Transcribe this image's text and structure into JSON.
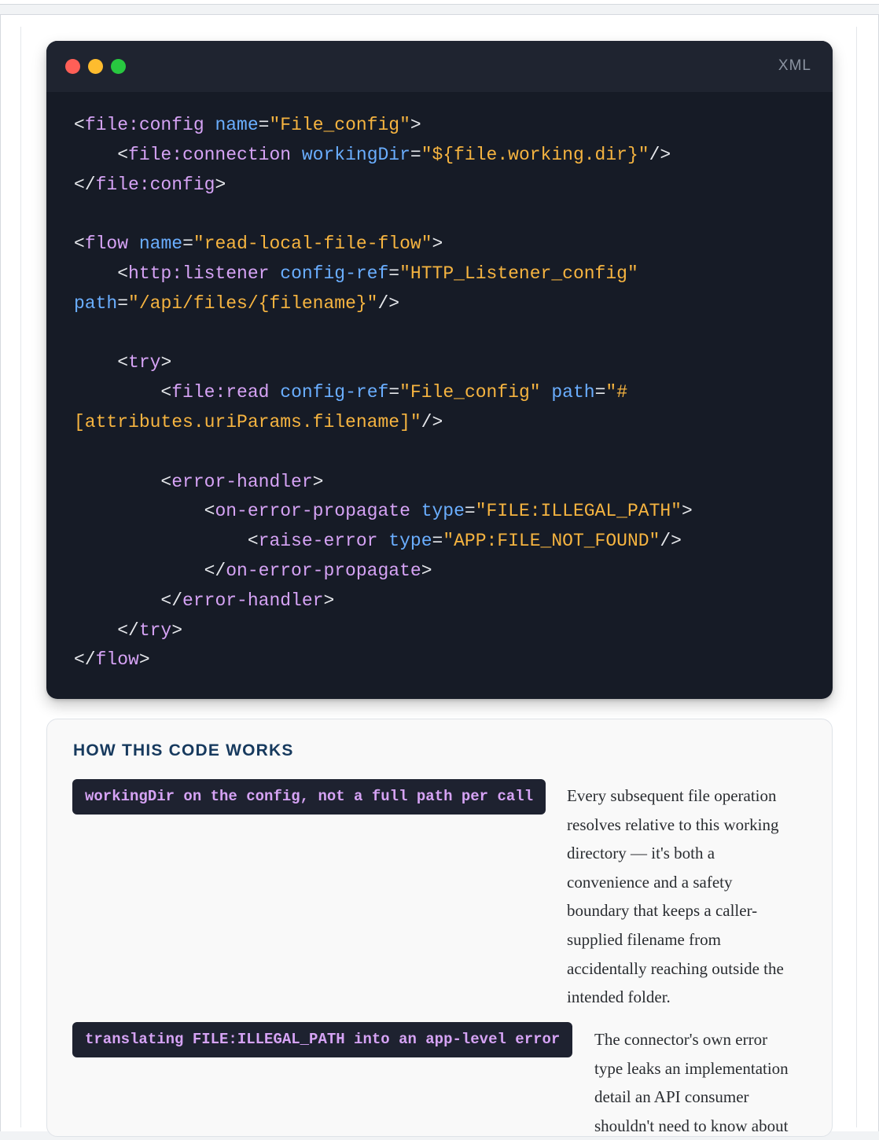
{
  "code_block": {
    "language": "XML",
    "lines": [
      [
        [
          "p",
          "<"
        ],
        [
          "t",
          "file:config"
        ],
        [
          "p",
          " "
        ],
        [
          "a",
          "name"
        ],
        [
          "p",
          "="
        ],
        [
          "s",
          "\"File_config\""
        ],
        [
          "p",
          ">"
        ]
      ],
      [
        [
          "p",
          "    <"
        ],
        [
          "t",
          "file:connection"
        ],
        [
          "p",
          " "
        ],
        [
          "a",
          "workingDir"
        ],
        [
          "p",
          "="
        ],
        [
          "s",
          "\"${file.working.dir}\""
        ],
        [
          "p",
          "/>"
        ]
      ],
      [
        [
          "p",
          "</"
        ],
        [
          "t",
          "file:config"
        ],
        [
          "p",
          ">"
        ]
      ],
      [],
      [
        [
          "p",
          "<"
        ],
        [
          "t",
          "flow"
        ],
        [
          "p",
          " "
        ],
        [
          "a",
          "name"
        ],
        [
          "p",
          "="
        ],
        [
          "s",
          "\"read-local-file-flow\""
        ],
        [
          "p",
          ">"
        ]
      ],
      [
        [
          "p",
          "    <"
        ],
        [
          "t",
          "http:listener"
        ],
        [
          "p",
          " "
        ],
        [
          "a",
          "config-ref"
        ],
        [
          "p",
          "="
        ],
        [
          "s",
          "\"HTTP_Listener_config\""
        ]
      ],
      [
        [
          "a",
          "path"
        ],
        [
          "p",
          "="
        ],
        [
          "s",
          "\"/api/files/{filename}\""
        ],
        [
          "p",
          "/>"
        ]
      ],
      [],
      [
        [
          "p",
          "    <"
        ],
        [
          "t",
          "try"
        ],
        [
          "p",
          ">"
        ]
      ],
      [
        [
          "p",
          "        <"
        ],
        [
          "t",
          "file:read"
        ],
        [
          "p",
          " "
        ],
        [
          "a",
          "config-ref"
        ],
        [
          "p",
          "="
        ],
        [
          "s",
          "\"File_config\""
        ],
        [
          "p",
          " "
        ],
        [
          "a",
          "path"
        ],
        [
          "p",
          "="
        ],
        [
          "s",
          "\"#"
        ]
      ],
      [
        [
          "s",
          "[attributes.uriParams.filename]\""
        ],
        [
          "p",
          "/>"
        ]
      ],
      [],
      [
        [
          "p",
          "        <"
        ],
        [
          "t",
          "error-handler"
        ],
        [
          "p",
          ">"
        ]
      ],
      [
        [
          "p",
          "            <"
        ],
        [
          "t",
          "on-error-propagate"
        ],
        [
          "p",
          " "
        ],
        [
          "a",
          "type"
        ],
        [
          "p",
          "="
        ],
        [
          "s",
          "\"FILE:ILLEGAL_PATH\""
        ],
        [
          "p",
          ">"
        ]
      ],
      [
        [
          "p",
          "                <"
        ],
        [
          "t",
          "raise-error"
        ],
        [
          "p",
          " "
        ],
        [
          "a",
          "type"
        ],
        [
          "p",
          "="
        ],
        [
          "s",
          "\"APP:FILE_NOT_FOUND\""
        ],
        [
          "p",
          "/>"
        ]
      ],
      [
        [
          "p",
          "            </"
        ],
        [
          "t",
          "on-error-propagate"
        ],
        [
          "p",
          ">"
        ]
      ],
      [
        [
          "p",
          "        </"
        ],
        [
          "t",
          "error-handler"
        ],
        [
          "p",
          ">"
        ]
      ],
      [
        [
          "p",
          "    </"
        ],
        [
          "t",
          "try"
        ],
        [
          "p",
          ">"
        ]
      ],
      [
        [
          "p",
          "</"
        ],
        [
          "t",
          "flow"
        ],
        [
          "p",
          ">"
        ]
      ]
    ]
  },
  "explanation": {
    "title": "HOW THIS CODE WORKS",
    "items": [
      {
        "term": "workingDir on the config, not a full path per call",
        "description_lines": [
          "Every subsequent file operation",
          "resolves relative to this working",
          "directory — it's both a",
          "convenience and a safety",
          "boundary that keeps a caller-",
          "supplied filename from",
          "accidentally reaching outside the",
          "intended folder."
        ]
      },
      {
        "term": "translating FILE:ILLEGAL_PATH into an app-level error",
        "description_lines": [
          "The connector's own error",
          "type leaks an implementation",
          "detail an API consumer",
          "shouldn't need to know about"
        ]
      }
    ]
  },
  "colors": {
    "tag": "#d6a3f5",
    "attribute": "#6aaeff",
    "string": "#f6b440",
    "punctuation": "#e6e8ec",
    "code_background": "#161b26",
    "header_title": "#173a5e"
  }
}
